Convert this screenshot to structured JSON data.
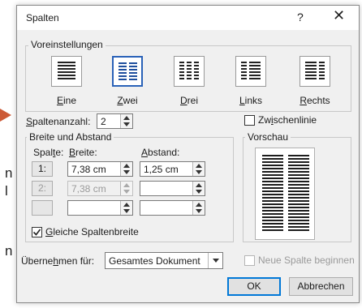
{
  "window": {
    "title": "Spalten",
    "help_glyph": "?",
    "close_glyph": "✕"
  },
  "presets": {
    "legend": "Voreinstellungen",
    "items": [
      {
        "id": "eine",
        "label": "Eine",
        "accel": "E",
        "rest": "ine",
        "columns": 1,
        "selected": false
      },
      {
        "id": "zwei",
        "label": "Zwei",
        "accel": "Z",
        "rest": "wei",
        "columns": 2,
        "selected": true
      },
      {
        "id": "drei",
        "label": "Drei",
        "accel": "D",
        "rest": "rei",
        "columns": 3,
        "selected": false
      },
      {
        "id": "links",
        "label": "Links",
        "accel": "L",
        "rest": "inks",
        "columns": 2,
        "selected": false
      },
      {
        "id": "rechts",
        "label": "Rechts",
        "accel": "R",
        "rest": "echts",
        "columns": 2,
        "selected": false
      }
    ]
  },
  "column_count": {
    "label_acc": "S",
    "label_rest": "paltenanzahl:",
    "value": "2"
  },
  "separator": {
    "label_pre": "Zw",
    "label_acc": "i",
    "label_post": "schenlinie",
    "checked": false
  },
  "width_spacing": {
    "legend": "Breite und Abstand",
    "col_header_pre": "Spal",
    "col_header_acc": "t",
    "col_header_post": "e:",
    "width_header_acc": "B",
    "width_header_rest": "reite:",
    "spacing_header_acc": "A",
    "spacing_header_rest": "bstand:",
    "rows": [
      {
        "col": "1:",
        "width": "7,38 cm",
        "spacing": "1,25 cm",
        "enabled": true
      },
      {
        "col": "2:",
        "width": "7,38 cm",
        "spacing": "",
        "enabled": false
      },
      {
        "col": "",
        "width": "",
        "spacing": "",
        "enabled": false
      }
    ],
    "equal_width": {
      "label_acc": "G",
      "label_rest": "leiche Spaltenbreite",
      "checked": true
    }
  },
  "preview": {
    "legend": "Vorschau"
  },
  "apply": {
    "label_pre": "Überne",
    "label_acc": "h",
    "label_post": "men für:",
    "selected": "Gesamtes Dokument"
  },
  "new_column": {
    "label": "Neue Spalte beginnen",
    "checked": false,
    "enabled": false
  },
  "buttons": {
    "ok": "OK",
    "cancel": "Abbrechen"
  },
  "background_doc": {
    "glyph_1": "n",
    "glyph_2": "l",
    "glyph_3": "n"
  },
  "colors": {
    "accent": "#2a62b8",
    "default_button": "#0078d7",
    "arrow": "#cc5a36"
  }
}
